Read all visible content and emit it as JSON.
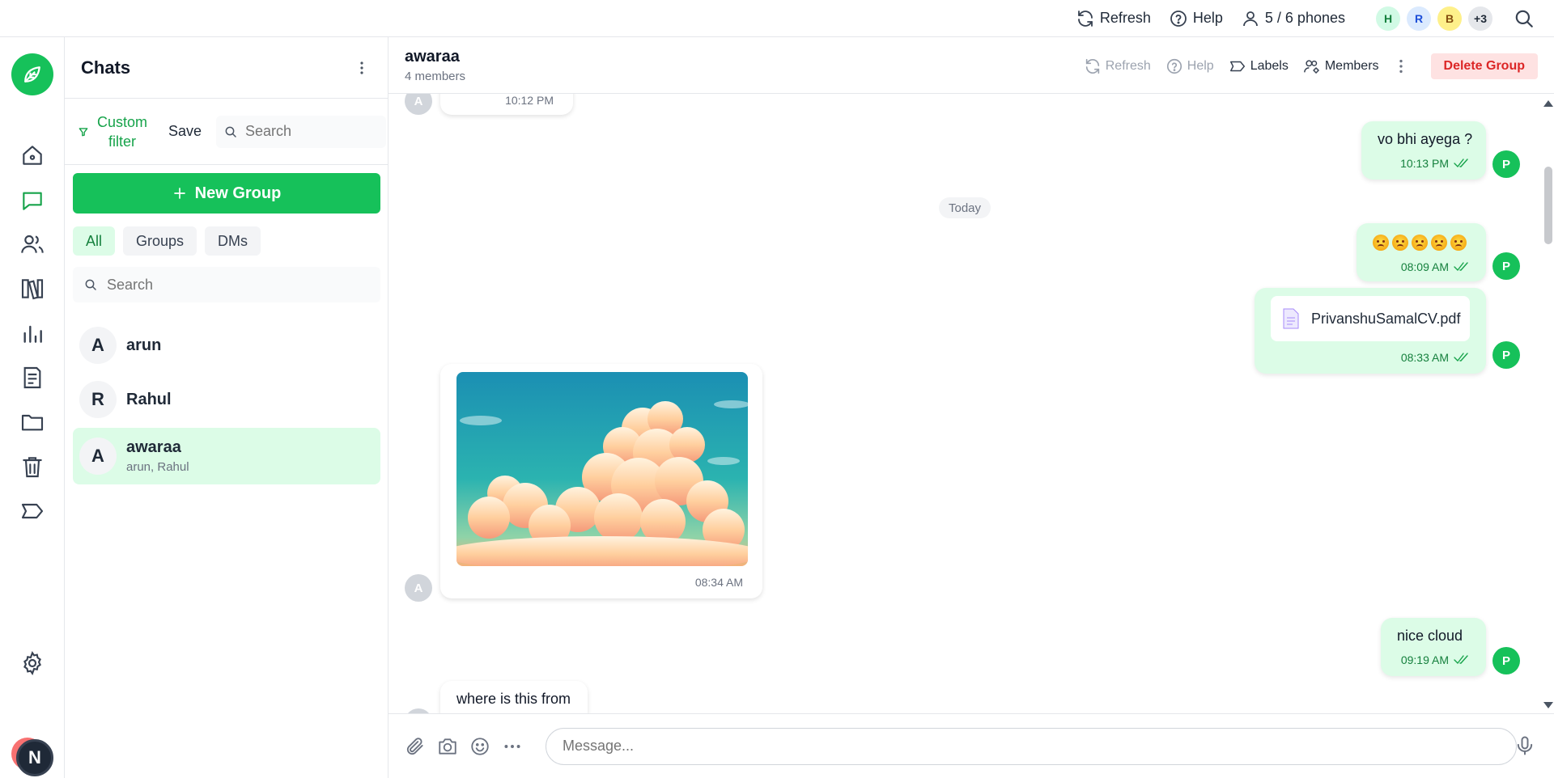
{
  "topbar": {
    "refresh": "Refresh",
    "help": "Help",
    "phones": "5 / 6 phones",
    "avatars": [
      {
        "label": "H",
        "bg": "#d1fae5",
        "fg": "#15803d"
      },
      {
        "label": "R",
        "bg": "#dbeafe",
        "fg": "#1d4ed8"
      },
      {
        "label": "B",
        "bg": "#fef08a",
        "fg": "#854d0e"
      },
      {
        "label": "+3",
        "bg": "#e5e7eb",
        "fg": "#1f2937"
      }
    ]
  },
  "rail": {
    "user_initial": "N",
    "items": [
      "home-icon",
      "chat-icon",
      "contacts-icon",
      "library-icon",
      "analytics-icon",
      "reports-icon",
      "folder-icon",
      "trash-icon",
      "label-icon",
      "settings-icon"
    ]
  },
  "panel": {
    "title": "Chats",
    "custom_filter": "Custom filter",
    "save": "Save",
    "filter_search_placeholder": "Search",
    "new_group": "New Group",
    "tabs": [
      "All",
      "Groups",
      "DMs"
    ],
    "list_search_placeholder": "Search",
    "chats": [
      {
        "initial": "A",
        "name": "arun",
        "sub": ""
      },
      {
        "initial": "R",
        "name": "Rahul",
        "sub": ""
      },
      {
        "initial": "A",
        "name": "awaraa",
        "sub": "arun, Rahul"
      }
    ]
  },
  "conversation": {
    "title": "awaraa",
    "subtitle": "4 members",
    "actions": {
      "refresh": "Refresh",
      "help": "Help",
      "labels": "Labels",
      "members": "Members",
      "delete_group": "Delete Group"
    },
    "divider": "Today",
    "messages": [
      {
        "dir": "in",
        "sender": "A",
        "text": "",
        "time": "10:12 PM"
      },
      {
        "dir": "out",
        "sender": "P",
        "text": "vo bhi ayega ?",
        "time": "10:13 PM"
      },
      {
        "dir": "out",
        "sender": "P",
        "text": "😩😩😩😩😩",
        "time": "08:09 AM"
      },
      {
        "dir": "out",
        "sender": "P",
        "file": "PrivanshuSamalCV.pdf",
        "time": "08:33 AM"
      },
      {
        "dir": "in",
        "sender": "A",
        "image": "sky-clouds",
        "time": "08:34 AM"
      },
      {
        "dir": "out",
        "sender": "P",
        "text": "nice cloud",
        "time": "09:19 AM"
      },
      {
        "dir": "in",
        "sender": "A",
        "text": "where is this from",
        "time": ""
      }
    ],
    "composer_placeholder": "Message..."
  },
  "colors": {
    "accent": "#16c15a",
    "outgoing_bubble": "#dcfce7",
    "danger": "#dc2626"
  }
}
